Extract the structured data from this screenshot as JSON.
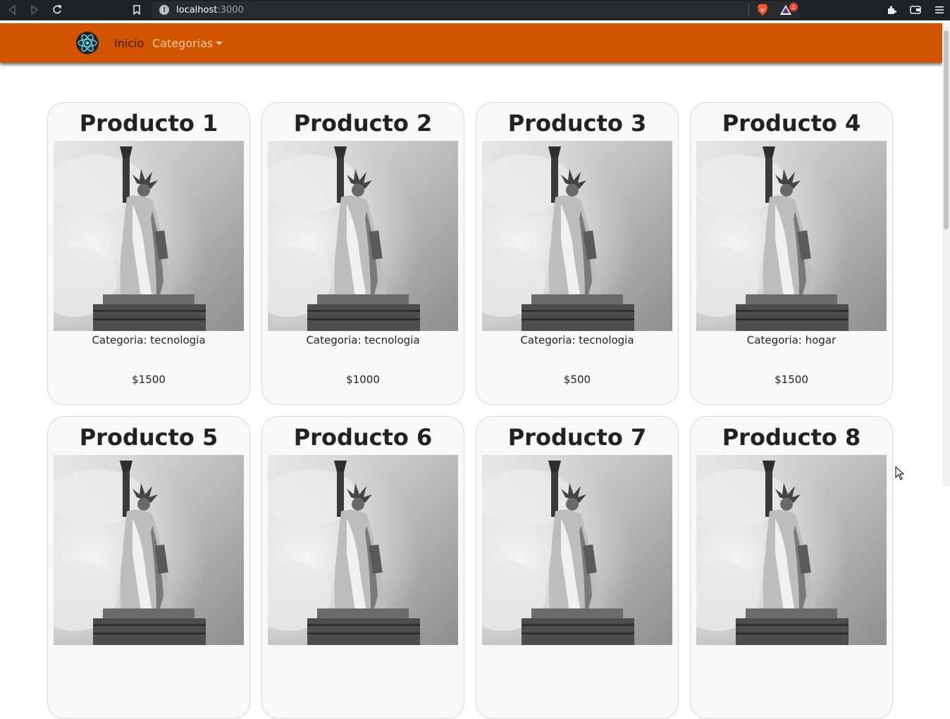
{
  "browser": {
    "url_host": "localhost",
    "url_port": ":3000",
    "rewards_badge": "1"
  },
  "navbar": {
    "home_label": "Inicio",
    "categories_label": "Categorias"
  },
  "products": [
    {
      "title": "Producto 1",
      "category": "Categoria: tecnologia",
      "price": "$1500"
    },
    {
      "title": "Producto 2",
      "category": "Categoria: tecnologia",
      "price": "$1000"
    },
    {
      "title": "Producto 3",
      "category": "Categoria: tecnologia",
      "price": "$500"
    },
    {
      "title": "Producto 4",
      "category": "Categoria: hogar",
      "price": "$1500"
    },
    {
      "title": "Producto 5"
    },
    {
      "title": "Producto 6"
    },
    {
      "title": "Producto 7"
    },
    {
      "title": "Producto 8"
    }
  ],
  "colors": {
    "navbar": "#d35400",
    "card_background": "#f8f8f8"
  }
}
